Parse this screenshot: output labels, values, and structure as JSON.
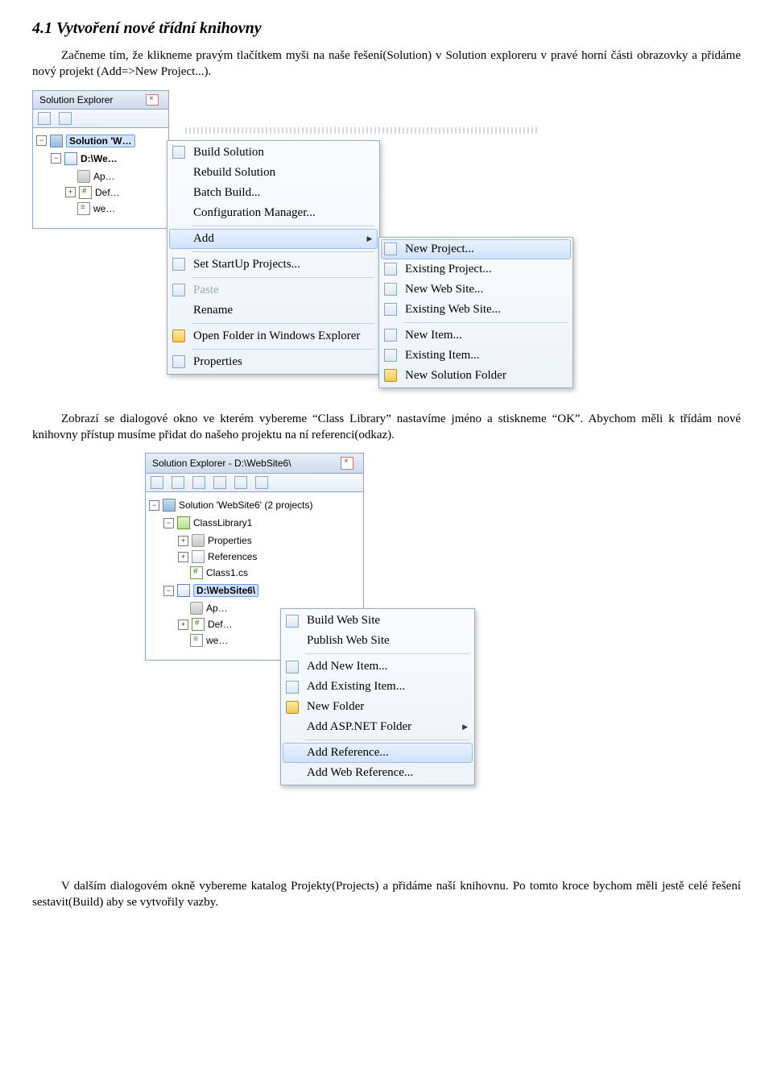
{
  "heading": "4.1 Vytvoření nové třídní knihovny",
  "para1": "Začneme tím, že klikneme pravým tlačítkem myši na naše řešení(Solution) v Solution exploreru v pravé horní části obrazovky a přidáme nový projekt (Add=>New Project...).",
  "para2": "Zobrazí se dialogové okno ve kterém vybereme “Class Library” nastavíme jméno a stiskneme “OK”. Abychom měli k třídám nové knihovny přístup musíme přidat do našeho projektu na ní referenci(odkaz).",
  "para3": "V dalším dialogovém okně vybereme katalog Projekty(Projects) a přidáme naší knihovnu. Po tomto kroce bychom měli jestě celé řešení sestavit(Build) aby se vytvořily vazby.",
  "se1": {
    "title": "Solution Explorer",
    "solution": "Solution 'W…",
    "project": "D:\\We…",
    "node_app": "Ap…",
    "node_def": "Def…",
    "node_web": "we…"
  },
  "menu1": {
    "build": "Build Solution",
    "rebuild": "Rebuild Solution",
    "batch": "Batch Build...",
    "config": "Configuration Manager...",
    "add": "Add",
    "startup": "Set StartUp Projects...",
    "paste": "Paste",
    "rename": "Rename",
    "open": "Open Folder in Windows Explorer",
    "props": "Properties"
  },
  "menu2": {
    "newproj": "New Project...",
    "exproj": "Existing Project...",
    "newweb": "New Web Site...",
    "exweb": "Existing Web Site...",
    "newitem": "New Item...",
    "exitem": "Existing Item...",
    "newfold": "New Solution Folder"
  },
  "se2": {
    "title": "Solution Explorer - D:\\WebSite6\\",
    "solution": "Solution 'WebSite6' (2 projects)",
    "lib": "ClassLibrary1",
    "props": "Properties",
    "refs": "References",
    "class1": "Class1.cs",
    "site": "D:\\WebSite6\\",
    "node_app": "Ap…",
    "node_def": "Def…",
    "node_web": "we…"
  },
  "menu3": {
    "buildweb": "Build Web Site",
    "pubweb": "Publish Web Site",
    "addnew": "Add New Item...",
    "addex": "Add Existing Item...",
    "newfold": "New Folder",
    "addasp": "Add ASP.NET Folder",
    "addref": "Add Reference...",
    "addwebref": "Add Web Reference..."
  }
}
